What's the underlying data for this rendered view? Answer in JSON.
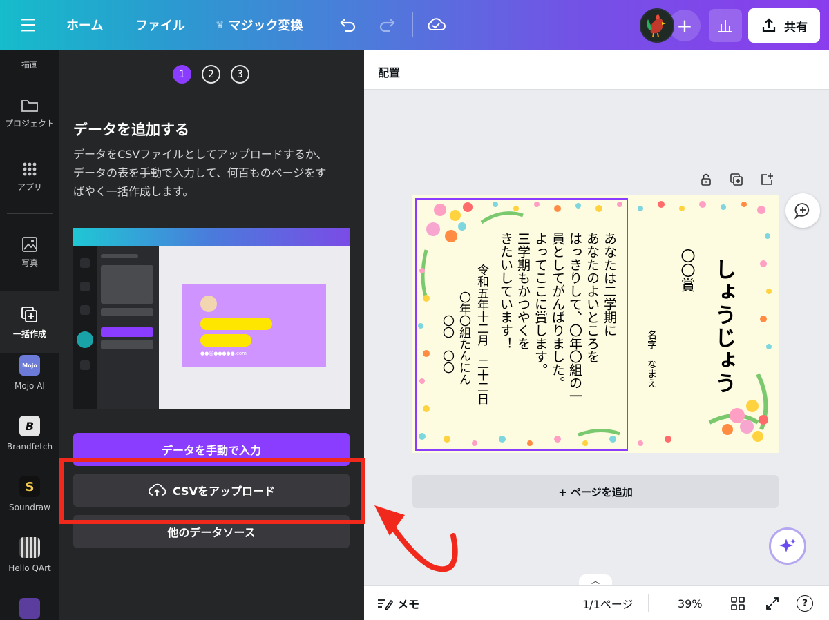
{
  "topbar": {
    "home": "ホーム",
    "file": "ファイル",
    "magic": "マジック変換",
    "share": "共有"
  },
  "rail": {
    "draw": "描画",
    "project": "プロジェクト",
    "apps": "アプリ",
    "photos": "写真",
    "bulk": "一括作成",
    "mojo": "Mojo AI",
    "brandfetch": "Brandfetch",
    "soundraw": "Soundraw",
    "helloqart": "Hello QArt"
  },
  "panel": {
    "steps": [
      "1",
      "2",
      "3"
    ],
    "title": "データを追加する",
    "desc_lines": [
      "データをCSVファイルとしてアップロードするか、",
      "データの表を手動で入力して、何百ものページをす",
      "ばやく一括作成します。"
    ],
    "illus_email": "●●@●●●●●.com",
    "manual_button": "データを手動で入力",
    "csv_button": "CSVをアップロード",
    "other_button": "他のデータソース"
  },
  "canvas": {
    "align_label": "配置",
    "add_page": "+ ページを追加"
  },
  "certificate": {
    "title": "しょうじょう",
    "award": "〇〇賞",
    "name_label": "名字　なまえ",
    "body_lines": [
      "あなたは二学期に",
      "あなたのよいところを",
      "はっきりして、〇年〇組の一",
      "員としてがんばりました。",
      "よってここに賞します。",
      "三学期もかつやくを",
      "きたいしています！"
    ],
    "date": "令和五年十二月　二十二日",
    "class": "〇年〇組たんにん",
    "teacher": "〇〇　〇〇"
  },
  "bottombar": {
    "memo": "メモ",
    "page": "1/1ページ",
    "zoom": "39%",
    "help": "?"
  },
  "colors": {
    "accent": "#8b3dff",
    "annotation": "#f0291c"
  }
}
